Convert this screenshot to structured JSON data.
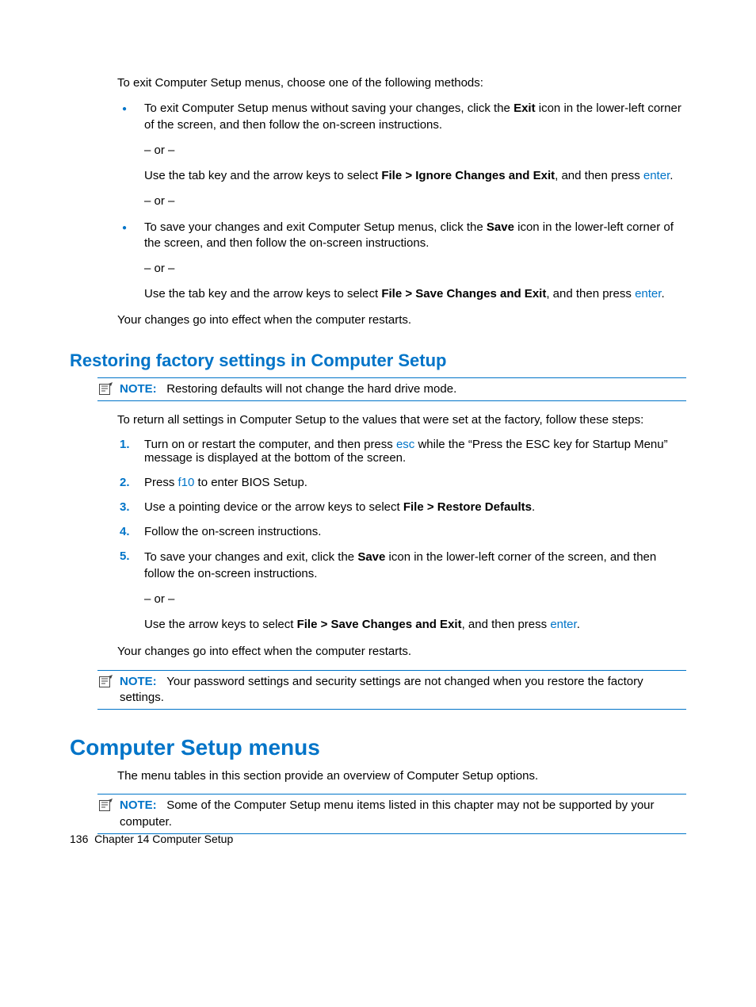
{
  "intro": "To exit Computer Setup menus, choose one of the following methods:",
  "or": "– or –",
  "bullet1": {
    "p1a": "To exit Computer Setup menus without saving your changes, click the ",
    "p1b": "Exit",
    "p1c": " icon in the lower-left corner of the screen, and then follow the on-screen instructions.",
    "p2a": "Use the tab key and the arrow keys to select ",
    "p2b": "File > Ignore Changes and Exit",
    "p2c": ", and then press ",
    "enter": "enter",
    "dot": "."
  },
  "bullet2": {
    "p1a": "To save your changes and exit Computer Setup menus, click the ",
    "p1b": "Save",
    "p1c": " icon in the lower-left corner of the screen, and then follow the on-screen instructions.",
    "p2a": "Use the tab key and the arrow keys to select ",
    "p2b": "File > Save Changes and Exit",
    "p2c": ", and then press ",
    "enter": "enter",
    "dot": "."
  },
  "afterExit": "Your changes go into effect when the computer restarts.",
  "h2": "Restoring factory settings in Computer Setup",
  "note1": {
    "label": "NOTE:",
    "text": "Restoring defaults will not change the hard drive mode."
  },
  "restoreIntro": "To return all settings in Computer Setup to the values that were set at the factory, follow these steps:",
  "step1": {
    "a": "Turn on or restart the computer, and then press ",
    "esc": "esc",
    "b": " while the “Press the ESC key for Startup Menu” message is displayed at the bottom of the screen."
  },
  "step2": {
    "a": "Press ",
    "f10": "f10",
    "b": " to enter BIOS Setup."
  },
  "step3": {
    "a": "Use a pointing device or the arrow keys to select ",
    "b": "File > Restore Defaults",
    "c": "."
  },
  "step4": "Follow the on-screen instructions.",
  "step5": {
    "a": "To save your changes and exit, click the ",
    "b": "Save",
    "c": " icon in the lower-left corner of the screen, and then follow the on-screen instructions.",
    "d": "Use the arrow keys to select ",
    "e": "File > Save Changes and Exit",
    "f": ", and then press ",
    "enter": "enter",
    "dot": "."
  },
  "afterRestore": "Your changes go into effect when the computer restarts.",
  "note2": {
    "label": "NOTE:",
    "text": "Your password settings and security settings are not changed when you restore the factory settings."
  },
  "h1": "Computer Setup menus",
  "menusIntro": "The menu tables in this section provide an overview of Computer Setup options.",
  "note3": {
    "label": "NOTE:",
    "text": "Some of the Computer Setup menu items listed in this chapter may not be supported by your computer."
  },
  "footer": {
    "page": "136",
    "chapter": "Chapter 14   Computer Setup"
  }
}
